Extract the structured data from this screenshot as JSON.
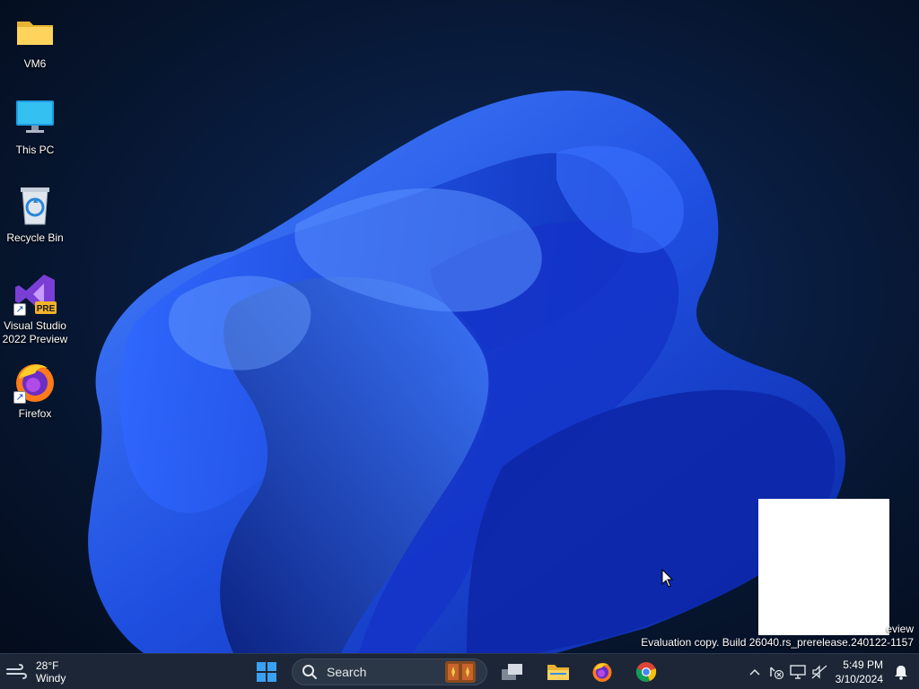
{
  "desktop": {
    "icons": [
      {
        "label": "VM6",
        "icon": "folder-icon"
      },
      {
        "label": "This PC",
        "icon": "monitor-icon"
      },
      {
        "label": "Recycle Bin",
        "icon": "recycle-bin-icon"
      },
      {
        "label": "Visual Studio 2022 Preview",
        "icon": "visual-studio-preview-icon",
        "badge": "PRE"
      },
      {
        "label": "Firefox",
        "icon": "firefox-icon"
      }
    ],
    "watermark_line1": "eview",
    "watermark_line2": "Evaluation copy. Build 26040.rs_prerelease.240122-1157"
  },
  "taskbar": {
    "weather": {
      "temp": "28°F",
      "condition": "Windy",
      "icon": "weather-wind-icon"
    },
    "start_icon": "windows-start-icon",
    "search_placeholder": "Search",
    "apps": [
      {
        "name": "Task View",
        "icon": "task-view-icon"
      },
      {
        "name": "File Explorer",
        "icon": "file-explorer-icon"
      },
      {
        "name": "Firefox",
        "icon": "firefox-icon"
      },
      {
        "name": "Google Chrome",
        "icon": "chrome-icon"
      }
    ],
    "tray": {
      "icons": [
        "chevron-up-icon",
        "network-disconnected-icon",
        "display-icon",
        "volume-muted-icon"
      ],
      "time": "5:49 PM",
      "date": "3/10/2024",
      "notification_icon": "bell-icon"
    }
  },
  "colors": {
    "taskbar_bg": "#1c2636",
    "wallpaper_bloom": "#1f4fe0",
    "accent": "#0078d4"
  }
}
